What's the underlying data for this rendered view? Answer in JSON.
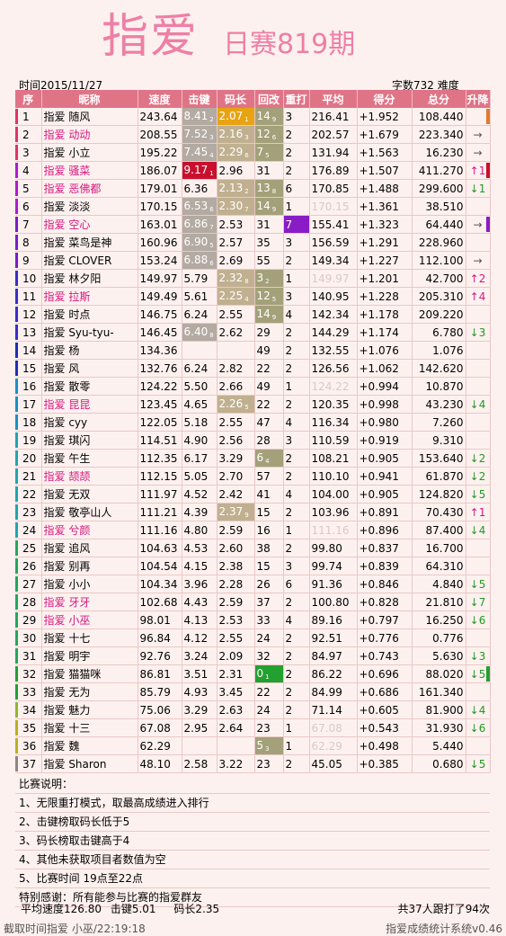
{
  "header": {
    "title": "指爱",
    "subtitle": "日赛819期",
    "time": "时间2015/11/27",
    "count_info": "字数732  难度"
  },
  "columns": [
    "序",
    "昵称",
    "速度",
    "击键",
    "码长",
    "回改",
    "重打",
    "平均",
    "得分",
    "总分",
    "升降"
  ],
  "rows": [
    {
      "rank": "1",
      "name": "指爱 随风",
      "name_pink": false,
      "speed": "243.64",
      "ks": "8.41",
      "ks_sub": "2",
      "ks_bg": "#b3aaa2",
      "cl": "2.07",
      "cl_sub": "1",
      "cl_bg": "#e8a312",
      "bs": "14",
      "bs_sub": "9",
      "bs_bg": "#a3a07a",
      "rt": "3",
      "avg": "216.41",
      "avg_gray": false,
      "score": "+1.952",
      "total": "108.440",
      "change": "",
      "change_dir": "",
      "bar": "#e0336c",
      "rbar": "#e07a2a"
    },
    {
      "rank": "2",
      "name": "指爱 动动",
      "name_pink": true,
      "speed": "208.55",
      "ks": "7.52",
      "ks_sub": "3",
      "ks_bg": "#b3aaa2",
      "cl": "2.16",
      "cl_sub": "3",
      "cl_bg": "#c0b090",
      "bs": "12",
      "bs_sub": "6",
      "bs_bg": "#a3a07a",
      "rt": "2",
      "avg": "202.57",
      "avg_gray": false,
      "score": "+1.679",
      "total": "223.340",
      "change": "→",
      "change_dir": "flat",
      "bar": "#e0336c",
      "rbar": ""
    },
    {
      "rank": "3",
      "name": "指爱 小立",
      "name_pink": false,
      "speed": "195.22",
      "ks": "7.45",
      "ks_sub": "4",
      "ks_bg": "#b3aaa2",
      "cl": "2.29",
      "cl_sub": "6",
      "cl_bg": "#c0b090",
      "bs": "7",
      "bs_sub": "5",
      "bs_bg": "#a3a07a",
      "rt": "2",
      "avg": "131.94",
      "avg_gray": false,
      "score": "+1.563",
      "total": "16.230",
      "change": "→",
      "change_dir": "flat",
      "bar": "#e0336c",
      "rbar": ""
    },
    {
      "rank": "4",
      "name": "指爱 骚菜",
      "name_pink": true,
      "speed": "186.07",
      "ks": "9.17",
      "ks_sub": "1",
      "ks_bg": "#c8102e",
      "cl": "2.96",
      "cl_sub": "",
      "cl_bg": "",
      "bs": "31",
      "bs_sub": "",
      "bs_bg": "",
      "rt": "2",
      "avg": "176.89",
      "avg_gray": false,
      "score": "+1.507",
      "total": "411.270",
      "change": "↑1",
      "change_dir": "up",
      "bar": "#b01bd0",
      "rbar": "#c8102e"
    },
    {
      "rank": "5",
      "name": "指爱 恶佛都",
      "name_pink": true,
      "speed": "179.01",
      "ks": "6.36",
      "ks_sub": "",
      "ks_bg": "",
      "cl": "2.13",
      "cl_sub": "2",
      "cl_bg": "#c0b090",
      "bs": "13",
      "bs_sub": "8",
      "bs_bg": "#a3a07a",
      "rt": "6",
      "avg": "170.85",
      "avg_gray": false,
      "score": "+1.488",
      "total": "299.600",
      "change": "↓1",
      "change_dir": "down",
      "bar": "#b01bd0",
      "rbar": ""
    },
    {
      "rank": "6",
      "name": "指爱 淡淡",
      "name_pink": false,
      "speed": "170.15",
      "ks": "6.53",
      "ks_sub": "6",
      "ks_bg": "#b3aaa2",
      "cl": "2.30",
      "cl_sub": "7",
      "cl_bg": "#c0b090",
      "bs": "14",
      "bs_sub": "9",
      "bs_bg": "#a3a07a",
      "rt": "1",
      "avg": "170.15",
      "avg_gray": true,
      "score": "+1.361",
      "total": "38.510",
      "change": "",
      "change_dir": "",
      "bar": "#b01bd0",
      "rbar": ""
    },
    {
      "rank": "7",
      "name": "指爱 空心",
      "name_pink": true,
      "speed": "163.01",
      "ks": "6.86",
      "ks_sub": "7",
      "ks_bg": "#b3aaa2",
      "cl": "2.53",
      "cl_sub": "",
      "cl_bg": "",
      "bs": "31",
      "bs_sub": "",
      "bs_bg": "",
      "rt": "7",
      "rt_bg": "#8a1cc6",
      "avg": "155.41",
      "avg_gray": false,
      "score": "+1.323",
      "total": "64.440",
      "change": "→",
      "change_dir": "flat",
      "bar": "#7a1cc8",
      "rbar": "#8a1cc6"
    },
    {
      "rank": "8",
      "name": "指爱 菜鸟是神",
      "name_pink": false,
      "speed": "160.96",
      "ks": "6.90",
      "ks_sub": "5",
      "ks_bg": "#b3aaa2",
      "cl": "2.57",
      "cl_sub": "",
      "cl_bg": "",
      "bs": "35",
      "bs_sub": "",
      "bs_bg": "",
      "rt": "3",
      "avg": "156.59",
      "avg_gray": false,
      "score": "+1.291",
      "total": "228.960",
      "change": "",
      "change_dir": "",
      "bar": "#7a1cc8",
      "rbar": ""
    },
    {
      "rank": "9",
      "name": "指爱 CLOVER",
      "name_pink": false,
      "speed": "153.24",
      "ks": "6.88",
      "ks_sub": "6",
      "ks_bg": "#b3aaa2",
      "cl": "2.69",
      "cl_sub": "",
      "cl_bg": "",
      "bs": "55",
      "bs_sub": "",
      "bs_bg": "",
      "rt": "2",
      "avg": "149.34",
      "avg_gray": false,
      "score": "+1.227",
      "total": "112.100",
      "change": "→",
      "change_dir": "flat",
      "bar": "#7a1cc8",
      "rbar": ""
    },
    {
      "rank": "10",
      "name": "指爱 林夕阳",
      "name_pink": false,
      "speed": "149.97",
      "ks": "5.79",
      "ks_sub": "",
      "ks_bg": "",
      "cl": "2.32",
      "cl_sub": "8",
      "cl_bg": "#c0b090",
      "bs": "3",
      "bs_sub": "2",
      "bs_bg": "#a3a07a",
      "rt": "1",
      "avg": "149.97",
      "avg_gray": true,
      "score": "+1.201",
      "total": "42.700",
      "change": "↑2",
      "change_dir": "up",
      "bar": "#3a2fc6",
      "rbar": ""
    },
    {
      "rank": "11",
      "name": "指爱 拉斯",
      "name_pink": true,
      "speed": "149.49",
      "ks": "5.61",
      "ks_sub": "",
      "ks_bg": "",
      "cl": "2.25",
      "cl_sub": "4",
      "cl_bg": "#c0b090",
      "bs": "12",
      "bs_sub": "5",
      "bs_bg": "#a3a07a",
      "rt": "3",
      "avg": "140.95",
      "avg_gray": false,
      "score": "+1.228",
      "total": "205.310",
      "change": "↑4",
      "change_dir": "up",
      "bar": "#3a2fc6",
      "rbar": ""
    },
    {
      "rank": "12",
      "name": "指爱 时点",
      "name_pink": false,
      "speed": "146.75",
      "ks": "6.24",
      "ks_sub": "",
      "ks_bg": "",
      "cl": "2.55",
      "cl_sub": "",
      "cl_bg": "",
      "bs": "14",
      "bs_sub": "9",
      "bs_bg": "#a3a07a",
      "rt": "4",
      "avg": "142.34",
      "avg_gray": false,
      "score": "+1.178",
      "total": "209.220",
      "change": "",
      "change_dir": "",
      "bar": "#3a2fc6",
      "rbar": ""
    },
    {
      "rank": "13",
      "name": "指爱 Syu-tyu-",
      "name_pink": false,
      "speed": "146.45",
      "ks": "6.40",
      "ks_sub": "8",
      "ks_bg": "#b3aaa2",
      "cl": "2.62",
      "cl_sub": "",
      "cl_bg": "",
      "bs": "29",
      "bs_sub": "",
      "bs_bg": "",
      "rt": "2",
      "avg": "144.29",
      "avg_gray": false,
      "score": "+1.174",
      "total": "6.780",
      "change": "↓3",
      "change_dir": "down",
      "bar": "#3a2fc6",
      "rbar": ""
    },
    {
      "rank": "14",
      "name": "指爱 杨",
      "name_pink": false,
      "speed": "134.36",
      "ks": "",
      "ks_sub": "",
      "ks_bg": "",
      "cl": "",
      "cl_sub": "",
      "cl_bg": "",
      "bs": "49",
      "bs_sub": "",
      "bs_bg": "",
      "rt": "2",
      "avg": "132.55",
      "avg_gray": false,
      "score": "+1.076",
      "total": "1.076",
      "change": "",
      "change_dir": "",
      "bar": "#1d2fb8",
      "rbar": ""
    },
    {
      "rank": "15",
      "name": "指爱 风",
      "name_pink": false,
      "speed": "132.76",
      "ks": "6.24",
      "ks_sub": "",
      "ks_bg": "",
      "cl": "2.82",
      "cl_sub": "",
      "cl_bg": "",
      "bs": "22",
      "bs_sub": "",
      "bs_bg": "",
      "rt": "2",
      "avg": "126.56",
      "avg_gray": false,
      "score": "+1.062",
      "total": "142.620",
      "change": "",
      "change_dir": "",
      "bar": "#1d2fb8",
      "rbar": ""
    },
    {
      "rank": "16",
      "name": "指爱 散零",
      "name_pink": false,
      "speed": "124.22",
      "ks": "5.50",
      "ks_sub": "",
      "ks_bg": "",
      "cl": "2.66",
      "cl_sub": "",
      "cl_bg": "",
      "bs": "49",
      "bs_sub": "",
      "bs_bg": "",
      "rt": "1",
      "avg": "124.22",
      "avg_gray": true,
      "score": "+0.994",
      "total": "10.870",
      "change": "",
      "change_dir": "",
      "bar": "#1a8fc8",
      "rbar": ""
    },
    {
      "rank": "17",
      "name": "指爱 昆昆",
      "name_pink": true,
      "speed": "123.45",
      "ks": "4.65",
      "ks_sub": "",
      "ks_bg": "",
      "cl": "2.26",
      "cl_sub": "5",
      "cl_bg": "#c0b090",
      "bs": "22",
      "bs_sub": "",
      "bs_bg": "",
      "rt": "2",
      "avg": "120.35",
      "avg_gray": false,
      "score": "+0.998",
      "total": "43.230",
      "change": "↓4",
      "change_dir": "down",
      "bar": "#1a8fc8",
      "rbar": ""
    },
    {
      "rank": "18",
      "name": "指爱 cyy",
      "name_pink": false,
      "speed": "122.05",
      "ks": "5.18",
      "ks_sub": "",
      "ks_bg": "",
      "cl": "2.55",
      "cl_sub": "",
      "cl_bg": "",
      "bs": "47",
      "bs_sub": "",
      "bs_bg": "",
      "rt": "4",
      "avg": "116.34",
      "avg_gray": false,
      "score": "+0.980",
      "total": "7.260",
      "change": "",
      "change_dir": "",
      "bar": "#1a8fc8",
      "rbar": ""
    },
    {
      "rank": "19",
      "name": "指爱 琪闪",
      "name_pink": false,
      "speed": "114.51",
      "ks": "4.90",
      "ks_sub": "",
      "ks_bg": "",
      "cl": "2.56",
      "cl_sub": "",
      "cl_bg": "",
      "bs": "28",
      "bs_sub": "",
      "bs_bg": "",
      "rt": "3",
      "avg": "110.59",
      "avg_gray": false,
      "score": "+0.919",
      "total": "9.310",
      "change": "",
      "change_dir": "",
      "bar": "#1fa5b0",
      "rbar": ""
    },
    {
      "rank": "20",
      "name": "指爱 午生",
      "name_pink": false,
      "speed": "112.35",
      "ks": "6.17",
      "ks_sub": "",
      "ks_bg": "",
      "cl": "3.29",
      "cl_sub": "",
      "cl_bg": "",
      "bs": "6",
      "bs_sub": "4",
      "bs_bg": "#a3a07a",
      "rt": "2",
      "avg": "108.21",
      "avg_gray": false,
      "score": "+0.905",
      "total": "153.640",
      "change": "↓2",
      "change_dir": "down",
      "bar": "#1fa5b0",
      "rbar": ""
    },
    {
      "rank": "21",
      "name": "指爱 颉颉",
      "name_pink": true,
      "speed": "112.15",
      "ks": "5.05",
      "ks_sub": "",
      "ks_bg": "",
      "cl": "2.70",
      "cl_sub": "",
      "cl_bg": "",
      "bs": "57",
      "bs_sub": "",
      "bs_bg": "",
      "rt": "2",
      "avg": "110.10",
      "avg_gray": false,
      "score": "+0.941",
      "total": "61.870",
      "change": "↓2",
      "change_dir": "down",
      "bar": "#1fa5b0",
      "rbar": ""
    },
    {
      "rank": "22",
      "name": "指爱 无双",
      "name_pink": false,
      "speed": "111.97",
      "ks": "4.52",
      "ks_sub": "",
      "ks_bg": "",
      "cl": "2.42",
      "cl_sub": "",
      "cl_bg": "",
      "bs": "41",
      "bs_sub": "",
      "bs_bg": "",
      "rt": "4",
      "avg": "104.00",
      "avg_gray": false,
      "score": "+0.905",
      "total": "124.820",
      "change": "↓5",
      "change_dir": "down",
      "bar": "#1fa5b0",
      "rbar": ""
    },
    {
      "rank": "23",
      "name": "指爱 敬亭山人",
      "name_pink": false,
      "speed": "111.21",
      "ks": "4.39",
      "ks_sub": "",
      "ks_bg": "",
      "cl": "2.37",
      "cl_sub": "9",
      "cl_bg": "#c0b090",
      "bs": "15",
      "bs_sub": "",
      "bs_bg": "",
      "rt": "2",
      "avg": "103.96",
      "avg_gray": false,
      "score": "+0.891",
      "total": "70.430",
      "change": "↑1",
      "change_dir": "up",
      "bar": "#1fa5b0",
      "rbar": ""
    },
    {
      "rank": "24",
      "name": "指爱 兮颜",
      "name_pink": true,
      "speed": "111.16",
      "ks": "4.80",
      "ks_sub": "",
      "ks_bg": "",
      "cl": "2.59",
      "cl_sub": "",
      "cl_bg": "",
      "bs": "16",
      "bs_sub": "",
      "bs_bg": "",
      "rt": "1",
      "avg": "111.16",
      "avg_gray": true,
      "score": "+0.896",
      "total": "87.400",
      "change": "↓4",
      "change_dir": "down",
      "bar": "#1fa5b0",
      "rbar": ""
    },
    {
      "rank": "25",
      "name": "指爱 追风",
      "name_pink": false,
      "speed": "104.63",
      "ks": "4.53",
      "ks_sub": "",
      "ks_bg": "",
      "cl": "2.60",
      "cl_sub": "",
      "cl_bg": "",
      "bs": "38",
      "bs_sub": "",
      "bs_bg": "",
      "rt": "2",
      "avg": "99.80",
      "avg_gray": false,
      "score": "+0.837",
      "total": "16.700",
      "change": "",
      "change_dir": "",
      "bar": "#22a85a",
      "rbar": ""
    },
    {
      "rank": "26",
      "name": "指爱 别再",
      "name_pink": false,
      "speed": "104.54",
      "ks": "4.15",
      "ks_sub": "",
      "ks_bg": "",
      "cl": "2.38",
      "cl_sub": "",
      "cl_bg": "",
      "bs": "15",
      "bs_sub": "",
      "bs_bg": "",
      "rt": "3",
      "avg": "99.74",
      "avg_gray": false,
      "score": "+0.839",
      "total": "64.310",
      "change": "",
      "change_dir": "",
      "bar": "#22a85a",
      "rbar": ""
    },
    {
      "rank": "27",
      "name": "指爱 小小",
      "name_pink": false,
      "speed": "104.34",
      "ks": "3.96",
      "ks_sub": "",
      "ks_bg": "",
      "cl": "2.28",
      "cl_sub": "",
      "cl_bg": "",
      "bs": "26",
      "bs_sub": "",
      "bs_bg": "",
      "rt": "6",
      "avg": "91.36",
      "avg_gray": false,
      "score": "+0.846",
      "total": "4.840",
      "change": "↓5",
      "change_dir": "down",
      "bar": "#22a85a",
      "rbar": ""
    },
    {
      "rank": "28",
      "name": "指爱   牙牙",
      "name_pink": true,
      "speed": "102.68",
      "ks": "4.43",
      "ks_sub": "",
      "ks_bg": "",
      "cl": "2.59",
      "cl_sub": "",
      "cl_bg": "",
      "bs": "37",
      "bs_sub": "",
      "bs_bg": "",
      "rt": "2",
      "avg": "100.80",
      "avg_gray": false,
      "score": "+0.828",
      "total": "21.810",
      "change": "↓7",
      "change_dir": "down",
      "bar": "#22a85a",
      "rbar": ""
    },
    {
      "rank": "29",
      "name": "指爱 小巫",
      "name_pink": true,
      "speed": "98.01",
      "ks": "4.13",
      "ks_sub": "",
      "ks_bg": "",
      "cl": "2.53",
      "cl_sub": "",
      "cl_bg": "",
      "bs": "33",
      "bs_sub": "",
      "bs_bg": "",
      "rt": "4",
      "avg": "89.16",
      "avg_gray": false,
      "score": "+0.797",
      "total": "16.250",
      "change": "↓6",
      "change_dir": "down",
      "bar": "#22a85a",
      "rbar": ""
    },
    {
      "rank": "30",
      "name": "指爱 十七",
      "name_pink": false,
      "speed": "96.84",
      "ks": "4.12",
      "ks_sub": "",
      "ks_bg": "",
      "cl": "2.55",
      "cl_sub": "",
      "cl_bg": "",
      "bs": "24",
      "bs_sub": "",
      "bs_bg": "",
      "rt": "2",
      "avg": "92.51",
      "avg_gray": false,
      "score": "+0.776",
      "total": "0.776",
      "change": "",
      "change_dir": "",
      "bar": "#22a85a",
      "rbar": ""
    },
    {
      "rank": "31",
      "name": "指爱 明宇",
      "name_pink": false,
      "speed": "92.76",
      "ks": "3.24",
      "ks_sub": "",
      "ks_bg": "",
      "cl": "2.09",
      "cl_sub": "",
      "cl_bg": "",
      "bs": "32",
      "bs_sub": "",
      "bs_bg": "",
      "rt": "2",
      "avg": "84.97",
      "avg_gray": false,
      "score": "+0.743",
      "total": "5.630",
      "change": "↓3",
      "change_dir": "down",
      "bar": "#22a85a",
      "rbar": ""
    },
    {
      "rank": "32",
      "name": "指爱 猫猫咪",
      "name_pink": false,
      "speed": "86.81",
      "ks": "3.51",
      "ks_sub": "",
      "ks_bg": "",
      "cl": "2.31",
      "cl_sub": "",
      "cl_bg": "",
      "bs": "0",
      "bs_sub": "1",
      "bs_bg": "#22a030",
      "rt": "2",
      "avg": "86.22",
      "avg_gray": false,
      "score": "+0.696",
      "total": "88.020",
      "change": "↓5",
      "change_dir": "down",
      "bar": "#22a030",
      "rbar": "#22a030"
    },
    {
      "rank": "33",
      "name": "指爱 无为",
      "name_pink": false,
      "speed": "85.79",
      "ks": "4.93",
      "ks_sub": "",
      "ks_bg": "",
      "cl": "3.45",
      "cl_sub": "",
      "cl_bg": "",
      "bs": "22",
      "bs_sub": "",
      "bs_bg": "",
      "rt": "2",
      "avg": "84.99",
      "avg_gray": false,
      "score": "+0.686",
      "total": "161.340",
      "change": "",
      "change_dir": "",
      "bar": "#22a030",
      "rbar": ""
    },
    {
      "rank": "34",
      "name": "指爱 魅力",
      "name_pink": false,
      "speed": "75.06",
      "ks": "3.29",
      "ks_sub": "",
      "ks_bg": "",
      "cl": "2.63",
      "cl_sub": "",
      "cl_bg": "",
      "bs": "24",
      "bs_sub": "",
      "bs_bg": "",
      "rt": "2",
      "avg": "71.14",
      "avg_gray": false,
      "score": "+0.605",
      "total": "81.900",
      "change": "↓4",
      "change_dir": "down",
      "bar": "#8db82a",
      "rbar": ""
    },
    {
      "rank": "35",
      "name": "指爱 十三",
      "name_pink": false,
      "speed": "67.08",
      "ks": "2.95",
      "ks_sub": "",
      "ks_bg": "",
      "cl": "2.64",
      "cl_sub": "",
      "cl_bg": "",
      "bs": "23",
      "bs_sub": "",
      "bs_bg": "",
      "rt": "1",
      "avg": "67.08",
      "avg_gray": true,
      "score": "+0.543",
      "total": "31.930",
      "change": "↓6",
      "change_dir": "down",
      "bar": "#b8b020",
      "rbar": ""
    },
    {
      "rank": "36",
      "name": "指爱 魏",
      "name_pink": false,
      "speed": "62.29",
      "ks": "",
      "ks_sub": "",
      "ks_bg": "",
      "cl": "",
      "cl_sub": "",
      "cl_bg": "",
      "bs": "5",
      "bs_sub": "3",
      "bs_bg": "#a3a07a",
      "rt": "1",
      "avg": "62.29",
      "avg_gray": true,
      "score": "+0.498",
      "total": "5.440",
      "change": "",
      "change_dir": "",
      "bar": "#b8b020",
      "rbar": ""
    },
    {
      "rank": "37",
      "name": "指爱 Sharon",
      "name_pink": false,
      "speed": "48.10",
      "ks": "2.58",
      "ks_sub": "",
      "ks_bg": "",
      "cl": "3.22",
      "cl_sub": "",
      "cl_bg": "",
      "bs": "23",
      "bs_sub": "",
      "bs_bg": "",
      "rt": "2",
      "avg": "45.05",
      "avg_gray": false,
      "score": "+0.385",
      "total": "0.680",
      "change": "↓5",
      "change_dir": "down",
      "bar": "#888888",
      "rbar": ""
    }
  ],
  "notes": {
    "heading": "比赛说明：",
    "items": [
      "1、无限重打模式，取最高成绩进入排行",
      "2、击键榜取码长低于5",
      "3、码长榜取击键高于4",
      "4、其他未获取项目者数值为空",
      "5、比赛时间 19点至22点"
    ],
    "thanks": "特别感谢：所有能参与比赛的指爱群友"
  },
  "summary": {
    "avg_speed": "平均速度126.80",
    "avg_ks": "击键5.01",
    "avg_cl": "码长2.35",
    "total_info": "共37人跟打了94次"
  },
  "footer": {
    "left": "截取时间指爱 小巫/22:19:18",
    "right": "指爱成绩统计系统v0.46"
  }
}
